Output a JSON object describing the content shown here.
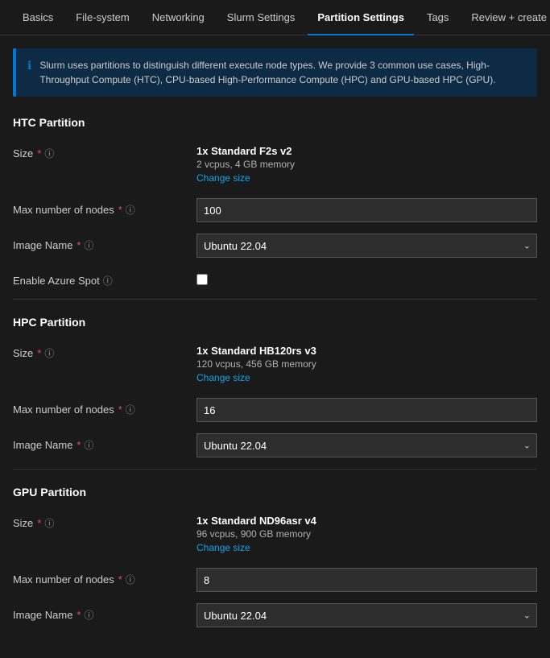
{
  "nav": {
    "items": [
      {
        "label": "Basics",
        "active": false
      },
      {
        "label": "File-system",
        "active": false
      },
      {
        "label": "Networking",
        "active": false
      },
      {
        "label": "Slurm Settings",
        "active": false
      },
      {
        "label": "Partition Settings",
        "active": true
      },
      {
        "label": "Tags",
        "active": false
      },
      {
        "label": "Review + create",
        "active": false
      }
    ]
  },
  "info_banner": {
    "text": "Slurm uses partitions to distinguish different execute node types. We provide 3 common use cases, High-Throughput Compute (HTC), CPU-based High-Performance Compute (HPC) and GPU-based HPC (GPU)."
  },
  "htc": {
    "header": "HTC Partition",
    "size_label": "Size",
    "size_name": "1x Standard F2s v2",
    "size_detail": "2 vcpus, 4 GB memory",
    "change_size": "Change size",
    "max_nodes_label": "Max number of nodes",
    "max_nodes_value": "100",
    "image_label": "Image Name",
    "image_value": "Ubuntu 22.04",
    "spot_label": "Enable Azure Spot"
  },
  "hpc": {
    "header": "HPC Partition",
    "size_label": "Size",
    "size_name": "1x Standard HB120rs v3",
    "size_detail": "120 vcpus, 456 GB memory",
    "change_size": "Change size",
    "max_nodes_label": "Max number of nodes",
    "max_nodes_value": "16",
    "image_label": "Image Name",
    "image_value": "Ubuntu 22.04"
  },
  "gpu": {
    "header": "GPU Partition",
    "size_label": "Size",
    "size_name": "1x Standard ND96asr v4",
    "size_detail": "96 vcpus, 900 GB memory",
    "change_size": "Change size",
    "max_nodes_label": "Max number of nodes",
    "max_nodes_value": "8",
    "image_label": "Image Name",
    "image_value": "Ubuntu 22.04"
  },
  "labels": {
    "required": "*",
    "info": "ⓘ",
    "chevron": "∨",
    "change_size": "Change size"
  }
}
